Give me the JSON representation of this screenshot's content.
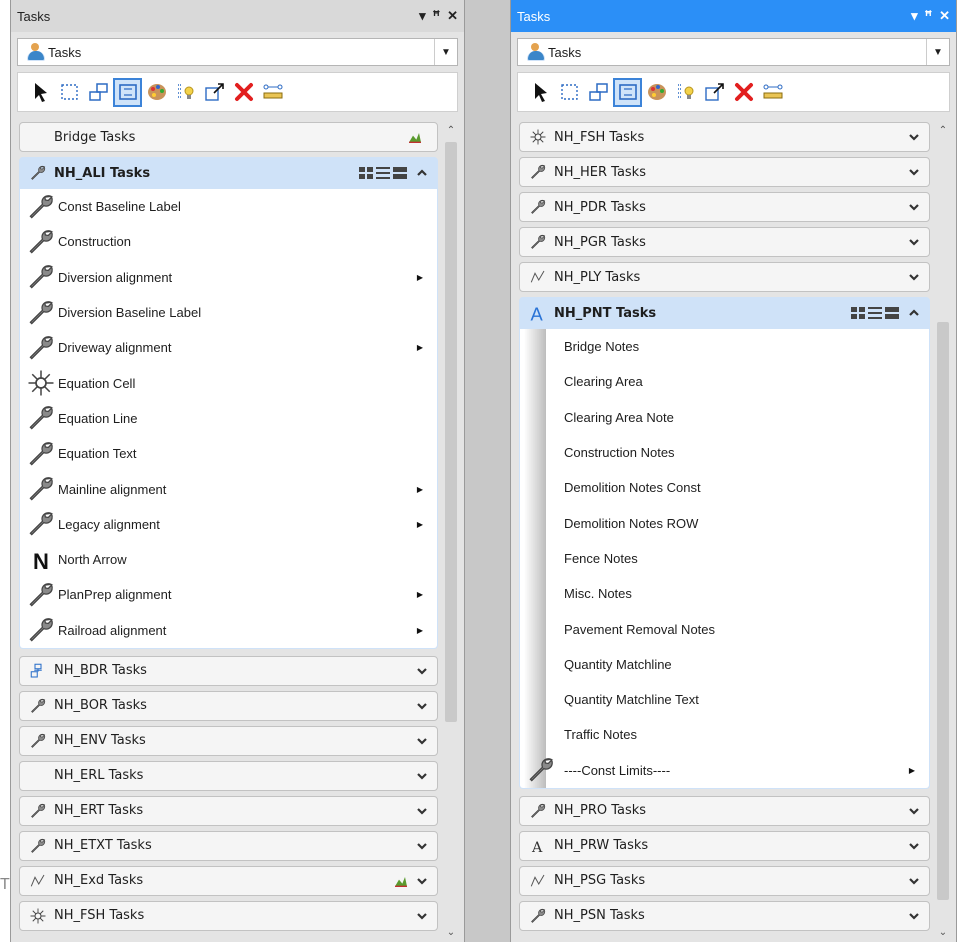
{
  "colors": {
    "accent": "#2b8ff7",
    "header_selected": "#cfe2f8",
    "panel_bg": "#e4e4e4"
  },
  "stray_char": "T",
  "left_panel": {
    "title": "Tasks",
    "title_buttons": [
      "▾",
      "ꟸ",
      "✕"
    ],
    "combo_value": "Tasks",
    "bridge_header": {
      "label": "Bridge Tasks",
      "icon": "surface-icon"
    },
    "open_group": {
      "label": "NH_ALI Tasks",
      "icon": "wrench-icon",
      "items": [
        {
          "label": "Const Baseline Label",
          "icon": "wrench-icon",
          "submenu": false
        },
        {
          "label": "Construction",
          "icon": "wrench-icon",
          "submenu": false
        },
        {
          "label": "Diversion alignment",
          "icon": "wrench-icon",
          "submenu": true
        },
        {
          "label": "Diversion Baseline Label",
          "icon": "wrench-icon",
          "submenu": false
        },
        {
          "label": "Driveway alignment",
          "icon": "wrench-icon",
          "submenu": true
        },
        {
          "label": "Equation Cell",
          "icon": "cell-icon",
          "submenu": false
        },
        {
          "label": "Equation Line",
          "icon": "wrench-icon",
          "submenu": false
        },
        {
          "label": "Equation Text",
          "icon": "wrench-icon",
          "submenu": false
        },
        {
          "label": "Mainline alignment",
          "icon": "wrench-icon",
          "submenu": true
        },
        {
          "label": "Legacy alignment",
          "icon": "wrench-icon",
          "submenu": true
        },
        {
          "label": "North Arrow",
          "icon": "north-arrow-icon",
          "submenu": false
        },
        {
          "label": "PlanPrep alignment",
          "icon": "wrench-icon",
          "submenu": true
        },
        {
          "label": "Railroad alignment",
          "icon": "wrench-icon",
          "submenu": true
        }
      ]
    },
    "groups_after": [
      {
        "label": "NH_BDR Tasks",
        "icon": "bridge-icon"
      },
      {
        "label": "NH_BOR Tasks",
        "icon": "wrench-icon"
      },
      {
        "label": "NH_ENV Tasks",
        "icon": "wrench-icon"
      },
      {
        "label": "NH_ERL Tasks",
        "icon": "none"
      },
      {
        "label": "NH_ERT Tasks",
        "icon": "wrench-icon"
      },
      {
        "label": "NH_ETXT Tasks",
        "icon": "wrench-icon"
      },
      {
        "label": "NH_Exd Tasks",
        "icon": "line-icon",
        "right_icon": "surface-icon"
      },
      {
        "label": "NH_FSH Tasks",
        "icon": "cell-icon"
      }
    ]
  },
  "right_panel": {
    "title": "Tasks",
    "title_buttons": [
      "▾",
      "ꟸ",
      "✕"
    ],
    "combo_value": "Tasks",
    "groups_before": [
      {
        "label": "NH_FSH Tasks",
        "icon": "cell-icon"
      },
      {
        "label": "NH_HER Tasks",
        "icon": "wrench-icon"
      },
      {
        "label": "NH_PDR Tasks",
        "icon": "wrench-icon"
      },
      {
        "label": "NH_PGR Tasks",
        "icon": "wrench-icon"
      },
      {
        "label": "NH_PLY Tasks",
        "icon": "line-icon"
      }
    ],
    "open_group": {
      "label": "NH_PNT Tasks",
      "icon": "text-icon",
      "items": [
        {
          "label": "Bridge Notes",
          "submenu": false
        },
        {
          "label": "Clearing Area",
          "submenu": false
        },
        {
          "label": "Clearing Area Note",
          "submenu": false
        },
        {
          "label": "Construction Notes",
          "submenu": false
        },
        {
          "label": "Demolition Notes Const",
          "submenu": false
        },
        {
          "label": "Demolition Notes ROW",
          "submenu": false
        },
        {
          "label": "Fence Notes",
          "submenu": false
        },
        {
          "label": "Misc. Notes",
          "submenu": false
        },
        {
          "label": "Pavement Removal Notes",
          "submenu": false
        },
        {
          "label": "Quantity Matchline",
          "submenu": false
        },
        {
          "label": "Quantity Matchline Text",
          "submenu": false
        },
        {
          "label": "Traffic Notes",
          "submenu": false
        },
        {
          "label": "----Const Limits----",
          "submenu": true,
          "icon": "wrench-icon"
        }
      ]
    },
    "groups_after": [
      {
        "label": "NH_PRO Tasks",
        "icon": "wrench-icon"
      },
      {
        "label": "NH_PRW Tasks",
        "icon": "text-icon"
      },
      {
        "label": "NH_PSG Tasks",
        "icon": "line-icon"
      },
      {
        "label": "NH_PSN Tasks",
        "icon": "wrench-icon"
      }
    ]
  },
  "toolbar_icons": [
    "pointer-icon",
    "select-box-icon",
    "select-element-icon",
    "fence-icon",
    "palette-icon",
    "attributes-icon",
    "resize-icon",
    "delete-icon",
    "measure-icon"
  ]
}
